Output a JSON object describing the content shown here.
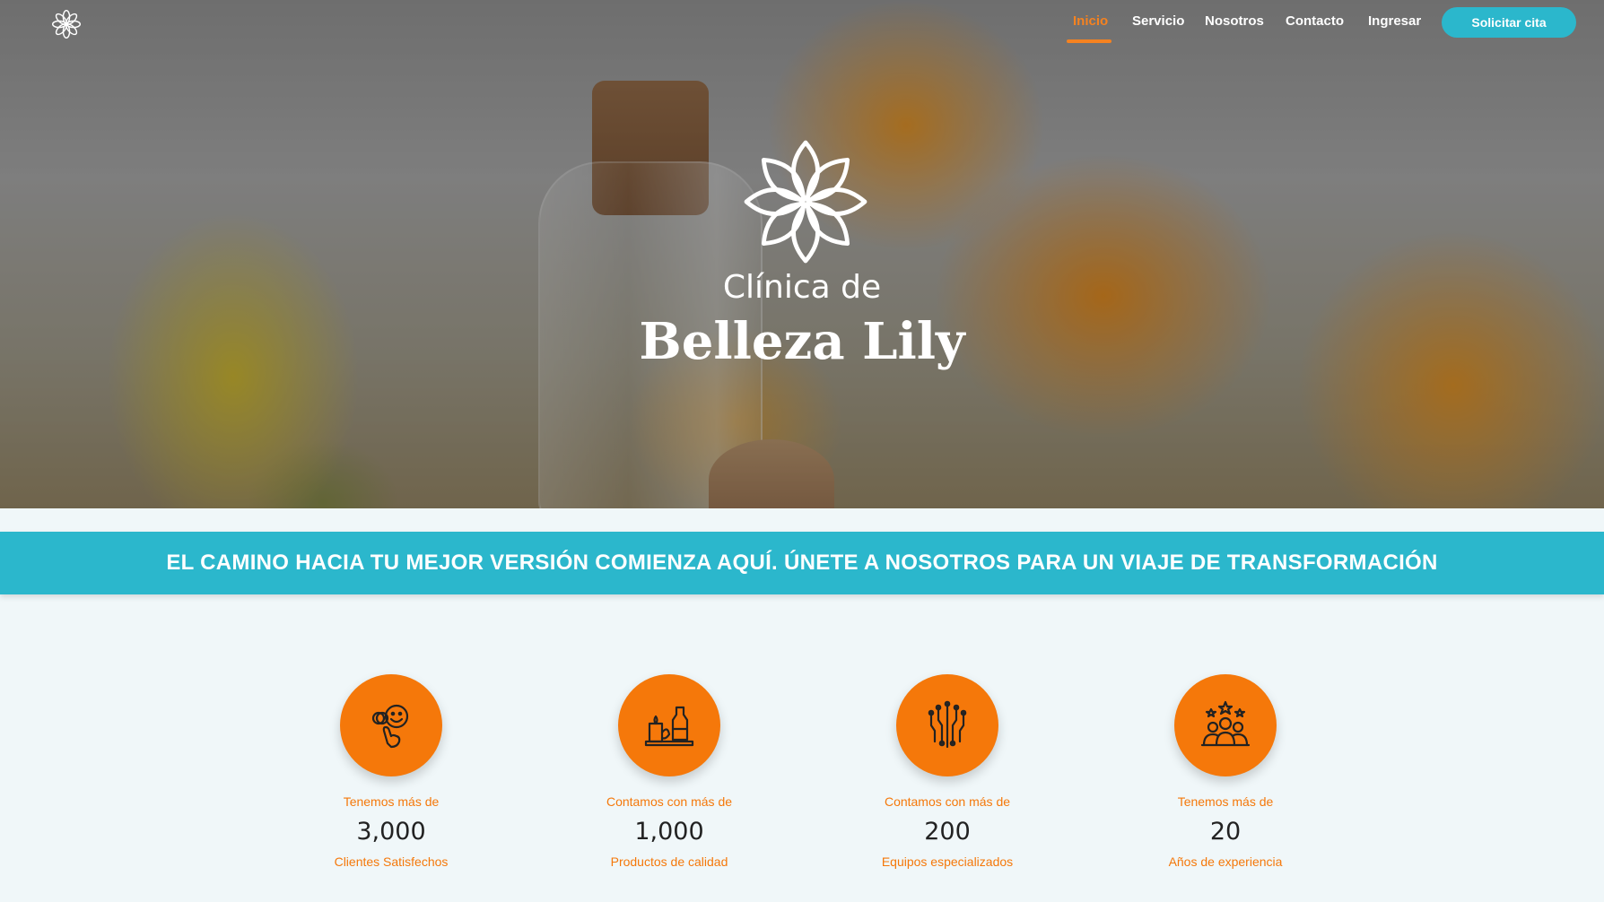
{
  "nav": {
    "items": [
      {
        "label": "Inicio",
        "active": true
      },
      {
        "label": "Servicio",
        "active": false
      },
      {
        "label": "Nosotros",
        "active": false
      },
      {
        "label": "Contacto",
        "active": false
      },
      {
        "label": "Ingresar",
        "active": false
      }
    ],
    "cta_label": "Solicitar cita",
    "logo_icon": "flower-logo-icon"
  },
  "hero": {
    "brand_line1": "Clínica de",
    "brand_line2": "Belleza Lily",
    "brand_icon": "lotus-flower-icon"
  },
  "banner": {
    "text": "EL CAMINO HACIA TU MEJOR VERSIÓN COMIENZA AQUÍ. ÚNETE A NOSOTROS PARA UN VIAJE DE TRANSFORMACIÓN"
  },
  "stats": [
    {
      "icon": "happy-client-icon",
      "pre": "Tenemos más de",
      "value": "3,000",
      "post": "Clientes Satisfechos"
    },
    {
      "icon": "beauty-products-icon",
      "pre": "Contamos con más de",
      "value": "1,000",
      "post": "Productos de calidad"
    },
    {
      "icon": "circuit-equipment-icon",
      "pre": "Contamos con más de",
      "value": "200",
      "post": "Equipos especializados"
    },
    {
      "icon": "team-stars-icon",
      "pre": "Tenemos más de",
      "value": "20",
      "post": "Años de experiencia"
    }
  ],
  "colors": {
    "accent_orange": "#f5780a",
    "nav_active": "#f58220",
    "teal": "#2bb7cc",
    "background": "#f0f7f9"
  }
}
